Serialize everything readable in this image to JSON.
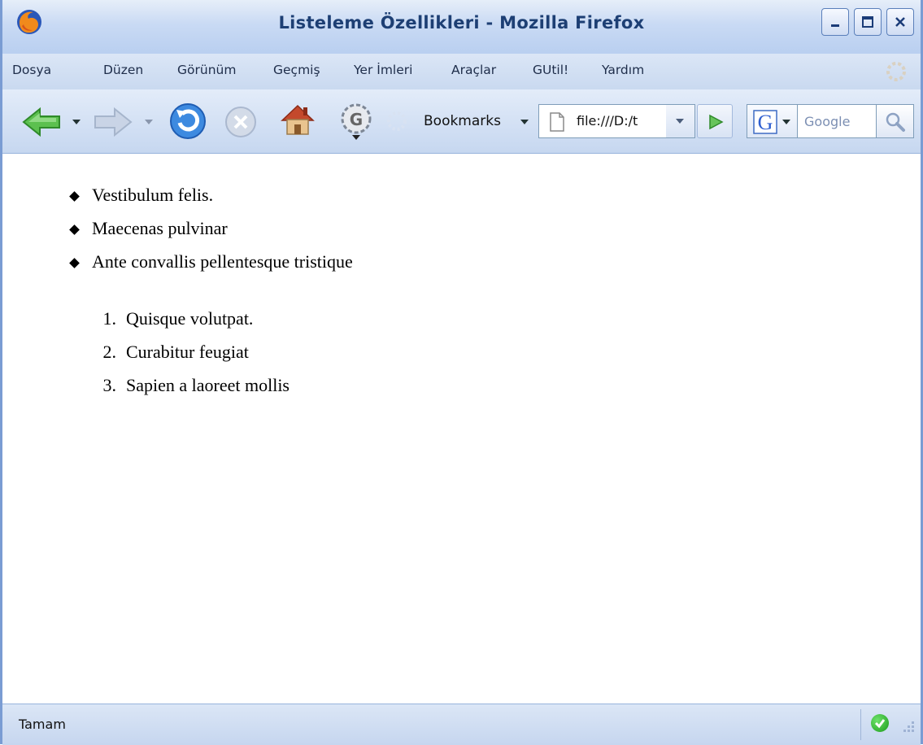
{
  "window": {
    "title": "Listeleme Özellikleri - Mozilla Firefox"
  },
  "menu": {
    "items": [
      "Dosya",
      "Düzen",
      "Görünüm",
      "Geçmiş",
      "Yer İmleri",
      "Araçlar",
      "GUtil!",
      "Yardım"
    ]
  },
  "toolbar": {
    "bookmarks_label": "Bookmarks",
    "url_value": "file:///D:/t",
    "search_placeholder": "Google",
    "icons": [
      "back-arrow-icon",
      "forward-arrow-icon",
      "reload-icon",
      "stop-icon",
      "home-icon",
      "gutil-icon",
      "spinner-icon",
      "page-icon",
      "go-arrow-icon",
      "google-logo-icon",
      "search-magnifier-icon"
    ]
  },
  "content": {
    "bullets": [
      "Vestibulum felis.",
      "Maecenas pulvinar",
      "Ante convallis pellentesque tristique"
    ],
    "numbered": [
      {
        "num": "1.",
        "text": "Quisque volutpat."
      },
      {
        "num": "2.",
        "text": "Curabitur feugiat"
      },
      {
        "num": "3.",
        "text": "Sapien a laoreet mollis"
      }
    ]
  },
  "status": {
    "text": "Tamam"
  },
  "colors": {
    "title_text": "#1d3f74",
    "accent_blue": "#7a9cd3",
    "ok_green": "#1b9a1b"
  }
}
